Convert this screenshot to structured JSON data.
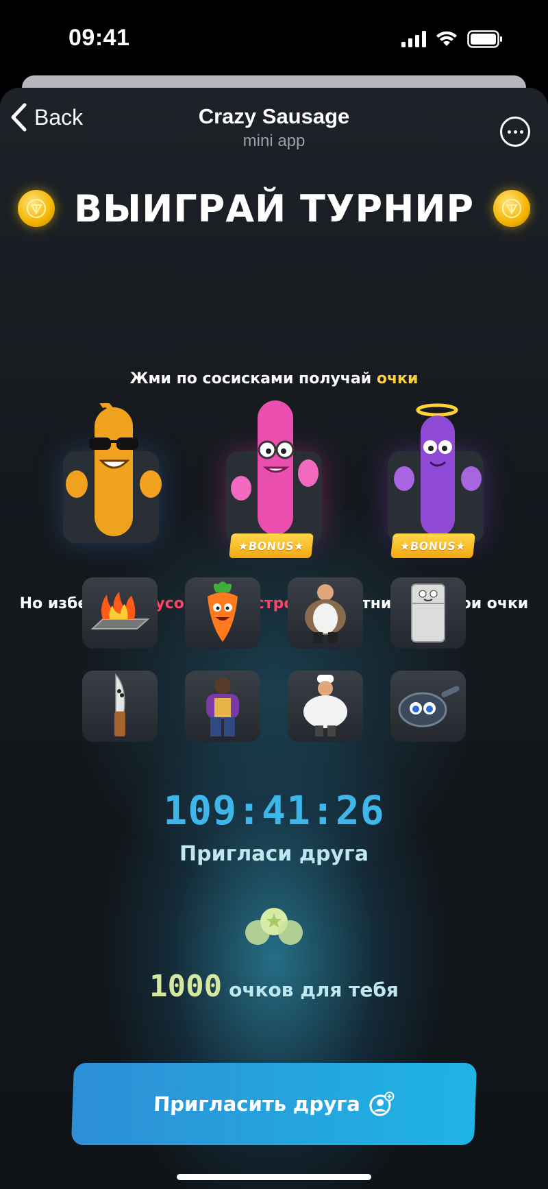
{
  "status_bar": {
    "time": "09:41"
  },
  "nav": {
    "back_label": "Back",
    "title": "Crazy Sausage",
    "subtitle": "mini app"
  },
  "headline": "ВЫИГРАЙ ТУРНИР",
  "tap_text": {
    "before": "Жми по сосисками получай ",
    "highlight": "очки"
  },
  "sausages": [
    {
      "name": "cool-sausage",
      "color": "#f0a21f",
      "bonus": null
    },
    {
      "name": "pink-sausage",
      "color": "#ea4fb0",
      "bonus": "BONUS"
    },
    {
      "name": "purple-sausage",
      "color": "#8f4bd6",
      "bonus": "BONUS"
    }
  ],
  "avoid_text": {
    "before": "Но избегай ",
    "highlight": "минусовых монстров",
    "after": ", они отнимают твои очки"
  },
  "monsters": [
    "grill-fire",
    "carrot",
    "fat-man",
    "fridge",
    "knife",
    "man-purple",
    "chef",
    "frying-pan"
  ],
  "timer": "109:41:26",
  "invite_title": "Пригласи друга",
  "reward": {
    "amount": "1000",
    "label": "очков для тебя"
  },
  "cta": {
    "label": "Пригласить друга"
  },
  "colors": {
    "accent_yellow": "#ffd23a",
    "accent_red": "#ff4467",
    "timer_blue": "#3fb6ea",
    "button_blue": "#2d8fd6"
  }
}
